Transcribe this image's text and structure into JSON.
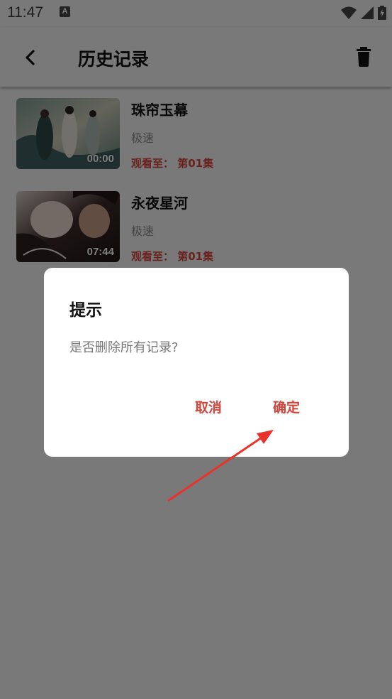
{
  "status_bar": {
    "time": "11:47",
    "notification_icon": "A"
  },
  "app_bar": {
    "title": "历史记录",
    "back_icon": "chevron-left-icon",
    "delete_icon": "trash-icon"
  },
  "history": [
    {
      "title": "珠帘玉幕",
      "source": "极速",
      "progress": "观看至： 第01集",
      "duration": "00:00"
    },
    {
      "title": "永夜星河",
      "source": "极速",
      "progress": "观看至： 第01集",
      "duration": "07:44"
    }
  ],
  "dialog": {
    "title": "提示",
    "message": "是否删除所有记录?",
    "cancel_label": "取消",
    "confirm_label": "确定"
  },
  "colors": {
    "accent": "#d2443a",
    "scrim": "rgba(0,0,0,0.5)"
  }
}
